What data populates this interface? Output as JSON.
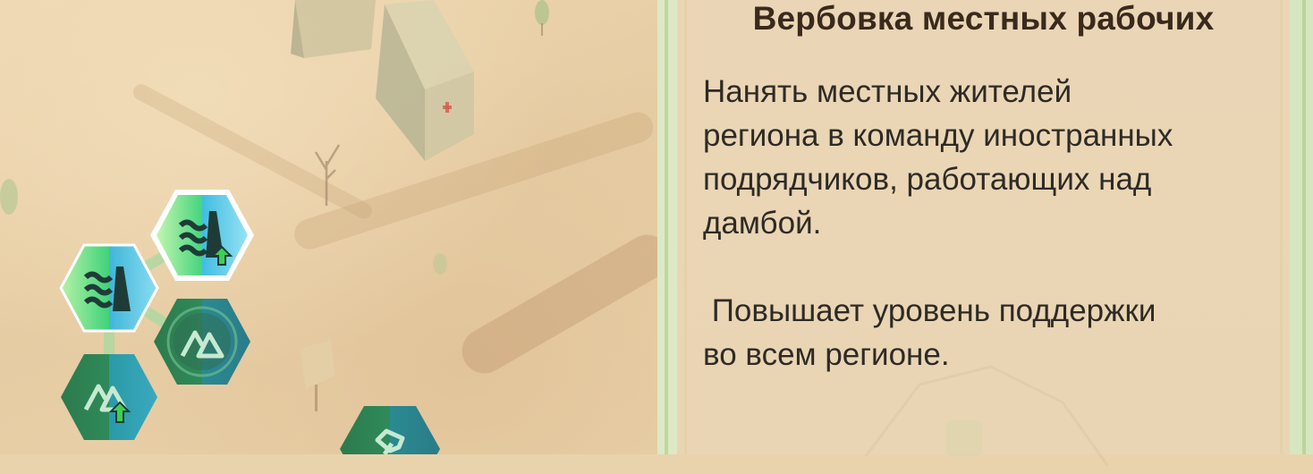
{
  "panel": {
    "title": "Вербовка местных рабочих",
    "description": "Нанять местных жителей\nрегиона в команду иностранных\nподрядчиков, работающих над\nдамбой.\n\n Повышает уровень поддержки\nво всем регионе."
  },
  "skill_tree": {
    "nodes": [
      {
        "name": "water-dam-node",
        "icon": "waves-dam-icon",
        "state": "unlocked"
      },
      {
        "name": "water-dam-upgrade-node",
        "icon": "waves-dam-upgrade-icon",
        "state": "selected"
      },
      {
        "name": "mountain-node",
        "icon": "mountains-icon",
        "state": "locked"
      },
      {
        "name": "mountain-upgrade-node",
        "icon": "mountains-upgrade-icon",
        "state": "locked"
      },
      {
        "name": "tools-node",
        "icon": "wrench-icon",
        "state": "locked"
      }
    ]
  },
  "colors": {
    "node_green": "#3fd27a",
    "node_blue": "#3fb6d9",
    "node_dark_green": "#2d7a4a",
    "title_text": "#3a2a1c"
  }
}
